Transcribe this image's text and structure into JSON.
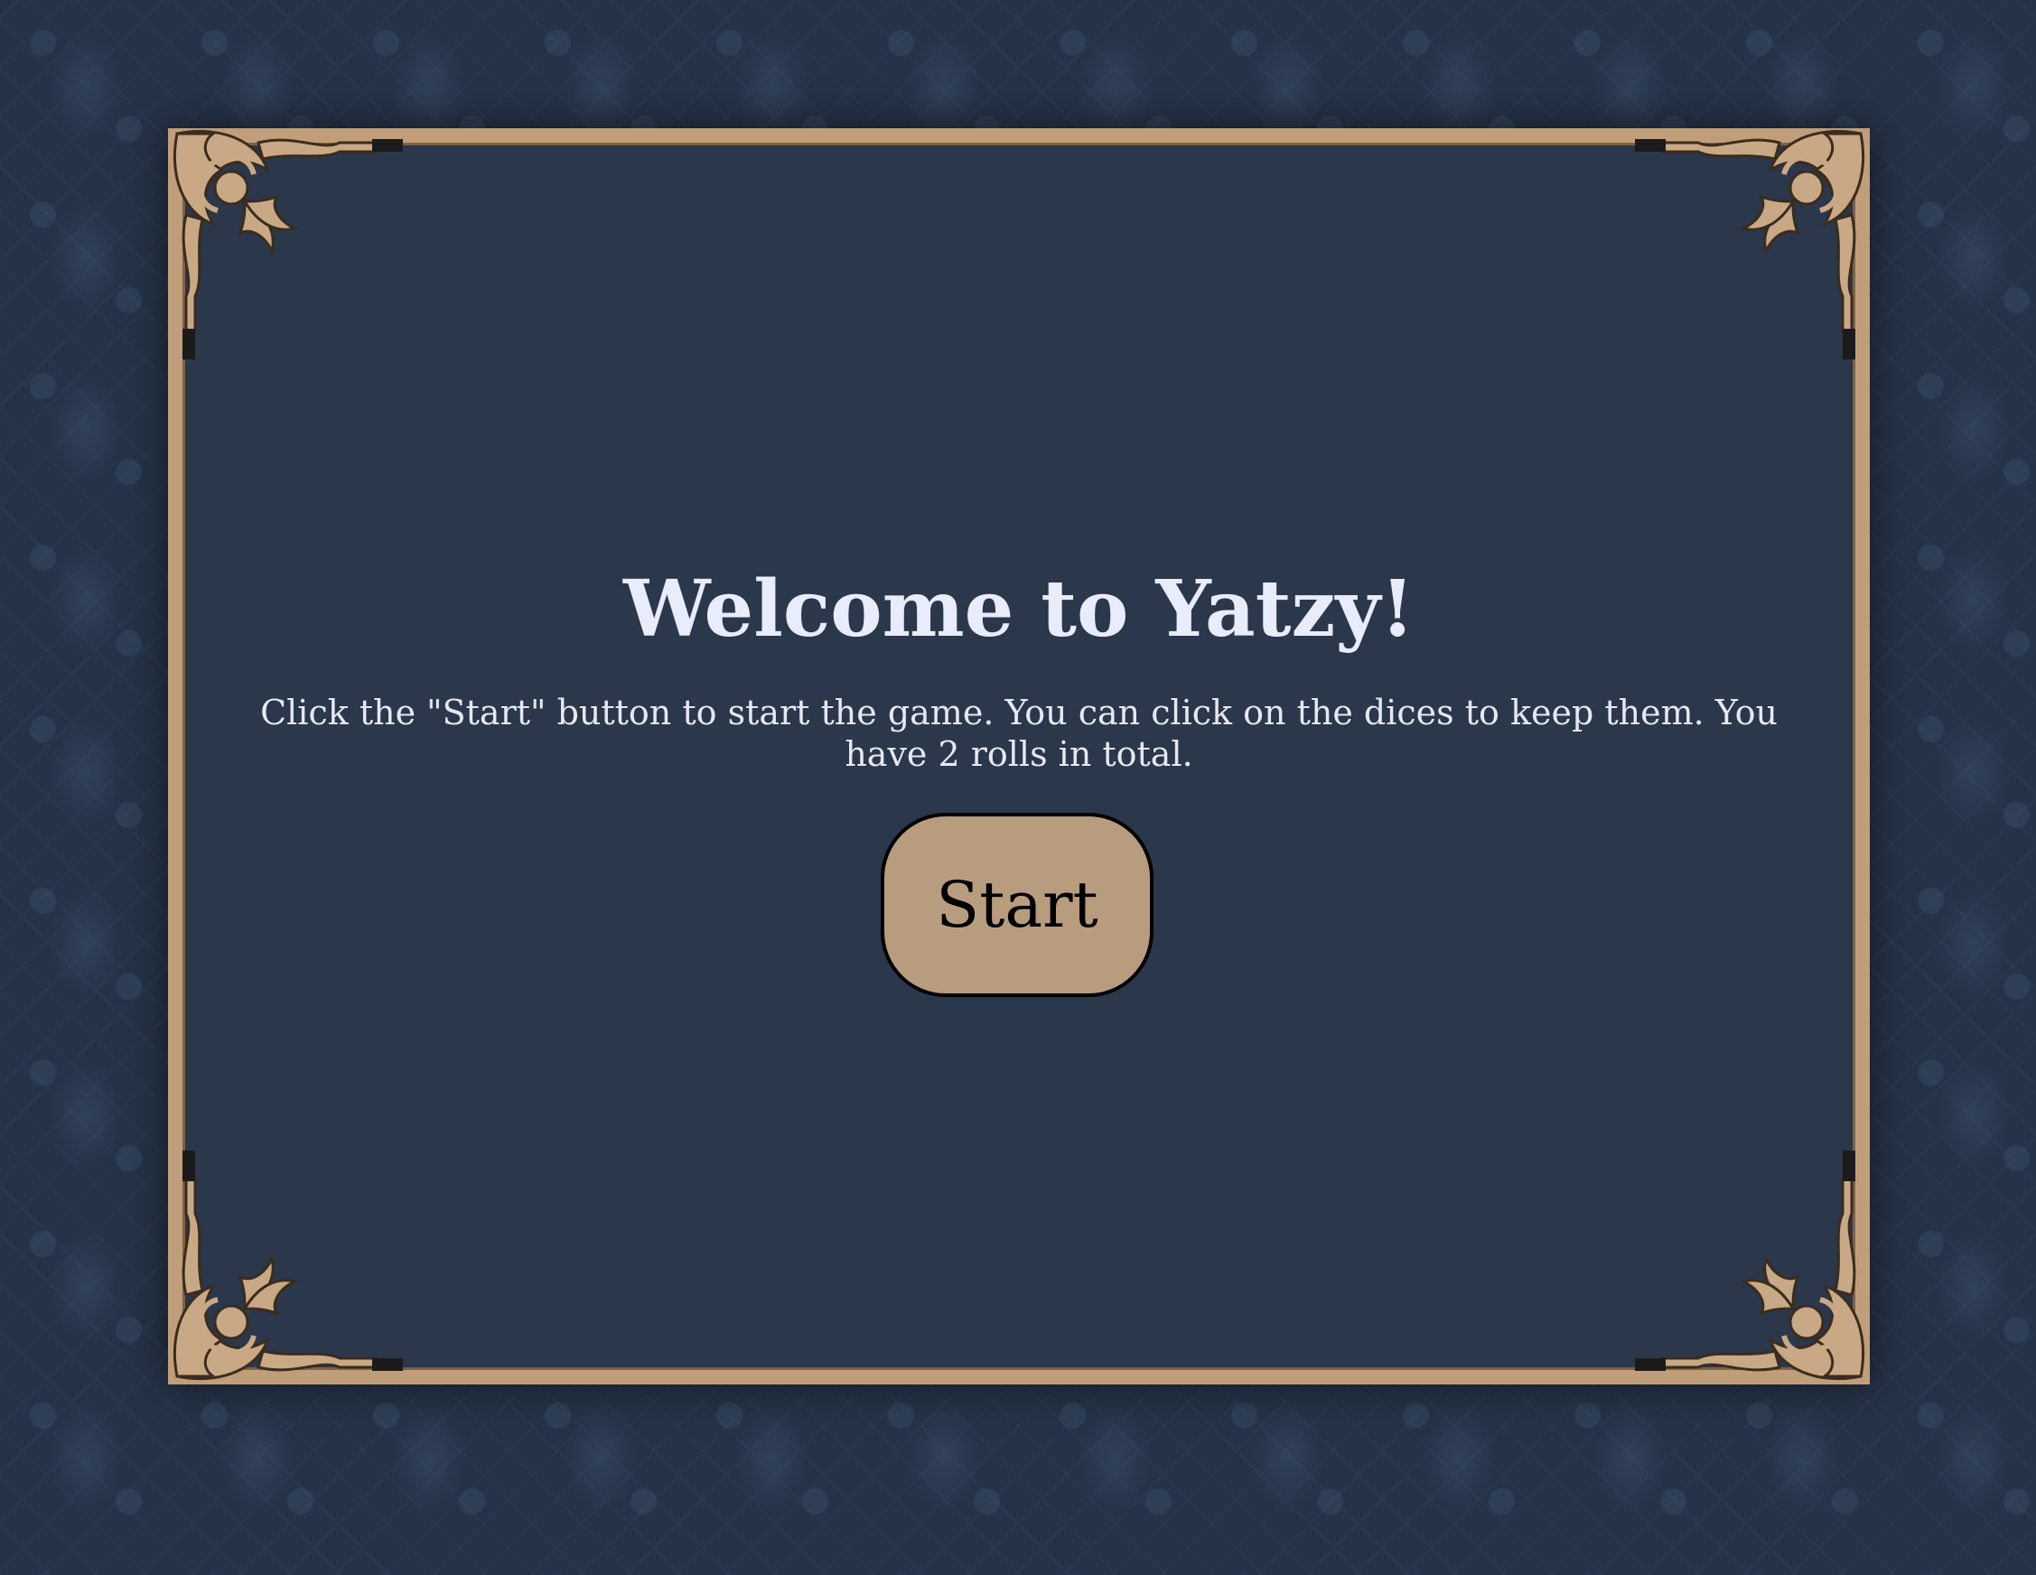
{
  "welcome": {
    "title": "Welcome to Yatzy!",
    "instructions": "Click the \"Start\" button to start the game. You can click on the dices to keep them. You have 2 rolls in total.",
    "start_label": "Start"
  },
  "colors": {
    "background": "#253247",
    "panel": "#2b374b",
    "frame_gold": "#c19e7a",
    "button": "#b89c7e",
    "title_text": "#e8ecfb"
  }
}
